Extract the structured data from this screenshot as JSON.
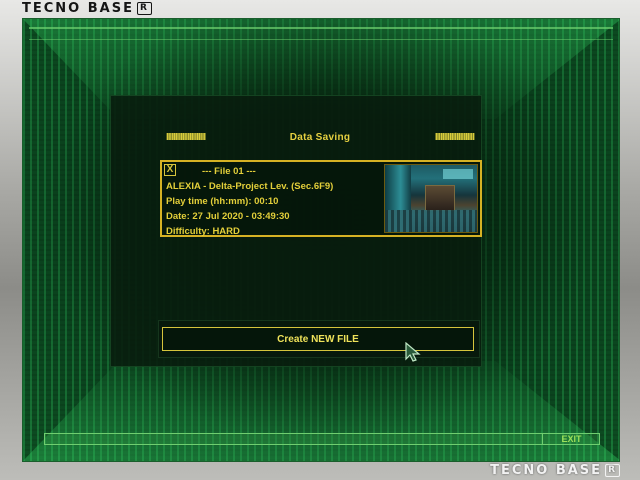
{
  "brand": {
    "top_logo": "TECNO BASE",
    "bottom_logo": "TECNO BASE",
    "registered_mark": "R"
  },
  "save_screen": {
    "title": "Data Saving",
    "title_bars_left": "IIIIIIIIIIIIIIIIIIIIII",
    "title_bars_right": "IIIIIIIIIIIIIIIIIIIIII",
    "slots": [
      {
        "check": "X",
        "header": "---   File 01   ---",
        "character_line": "ALEXIA - Delta-Project Lev. (Sec.6F9)",
        "play_time": "Play time (hh:mm):  00:10",
        "date": "Date:  27 Jul 2020 - 03:49:30",
        "difficulty": "Difficulty:   HARD"
      }
    ],
    "create_new_label": "Create  NEW FILE"
  },
  "footer": {
    "exit_label": "EXIT"
  },
  "colors": {
    "text_gold": "#e3cf3a",
    "slot_border": "#d6b224",
    "matrix_green": "#3cdc6e",
    "exit_green": "#9de05a"
  }
}
